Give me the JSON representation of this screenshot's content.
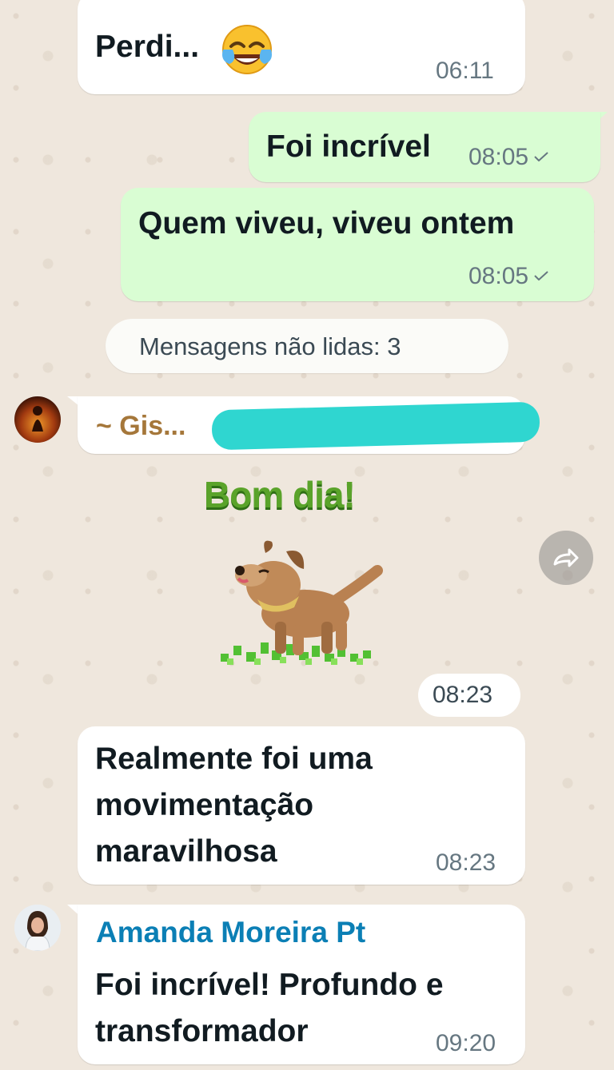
{
  "messages": [
    {
      "text": "Perdi...",
      "time": "06:11",
      "direction": "incoming",
      "emoji": "face-with-tears-of-joy"
    },
    {
      "text": "Foi incrível",
      "time": "08:05",
      "direction": "outgoing",
      "status": "sent"
    },
    {
      "text": "Quem viveu, viveu ontem",
      "time": "08:05",
      "direction": "outgoing",
      "status": "sent"
    }
  ],
  "unread_banner": "Mensagens não lidas: 3",
  "group": {
    "sender_gis": "~ Gis...",
    "sticker": {
      "caption": "Bom dia!",
      "time": "08:23",
      "icon": "dog-sticker"
    },
    "reply_lines": [
      "Realmente foi uma",
      "movimentação",
      "maravilhosa"
    ],
    "reply_time": "08:23",
    "amanda": {
      "name": "Amanda Moreira Pt",
      "lines": [
        "Foi incrível! Profundo e",
        "transformador"
      ],
      "time": "09:20"
    }
  },
  "colors": {
    "outgoing_bubble": "#d9fdd3",
    "incoming_bubble": "#ffffff",
    "chat_background": "#efe7dd",
    "sender_gis_color": "#a5773a",
    "sender_amanda_color": "#0b7fb5",
    "redaction_color": "#2fd6d0",
    "sticker_text_color": "#5aa32a"
  }
}
